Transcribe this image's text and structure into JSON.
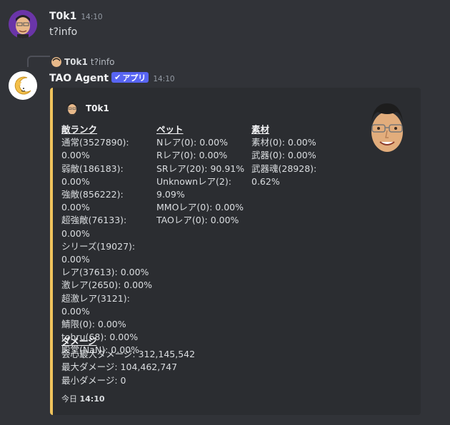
{
  "msg1": {
    "user": "T0k1",
    "time": "14:10",
    "text": "t?info"
  },
  "reply": {
    "user": "T0k1",
    "text": "t?info"
  },
  "msg2": {
    "user": "TAO Agent",
    "badge": "アプリ",
    "time": "14:10"
  },
  "embed": {
    "author": "T0k1",
    "accent_color": "#f0c35c",
    "columns": [
      {
        "title": "敵ランク",
        "lines": [
          "通常(3527890):",
          "0.00%",
          "弱敵(186183): 0.00%",
          "強敵(856222): 0.00%",
          "超強敵(76133):",
          "0.00%",
          "シリーズ(19027):",
          "0.00%",
          "レア(37613): 0.00%",
          "激レア(2650): 0.00%",
          "超激レア(3121):",
          "0.00%",
          "鯖限(0): 0.00%",
          "tohru(68): 0.00%",
          "殿堂(NaN): 0.00%"
        ]
      },
      {
        "title": "ペット",
        "lines": [
          "Nレア(0): 0.00%",
          "Rレア(0): 0.00%",
          "SRレア(20): 90.91%",
          "Unknownレア(2):",
          "9.09%",
          "MMOレア(0): 0.00%",
          "TAOレア(0): 0.00%"
        ]
      },
      {
        "title": "素材",
        "lines": [
          "素材(0): 0.00%",
          "武器(0): 0.00%",
          "武器魂(28928):",
          "0.62%"
        ]
      }
    ],
    "damage": {
      "title": "ダメージ",
      "lines": [
        "会心最大ダメージ: 312,145,542",
        "最大ダメージ: 104,462,747",
        "最小ダメージ: 0"
      ]
    },
    "footer": {
      "day": "今日",
      "time": "14:10"
    }
  }
}
